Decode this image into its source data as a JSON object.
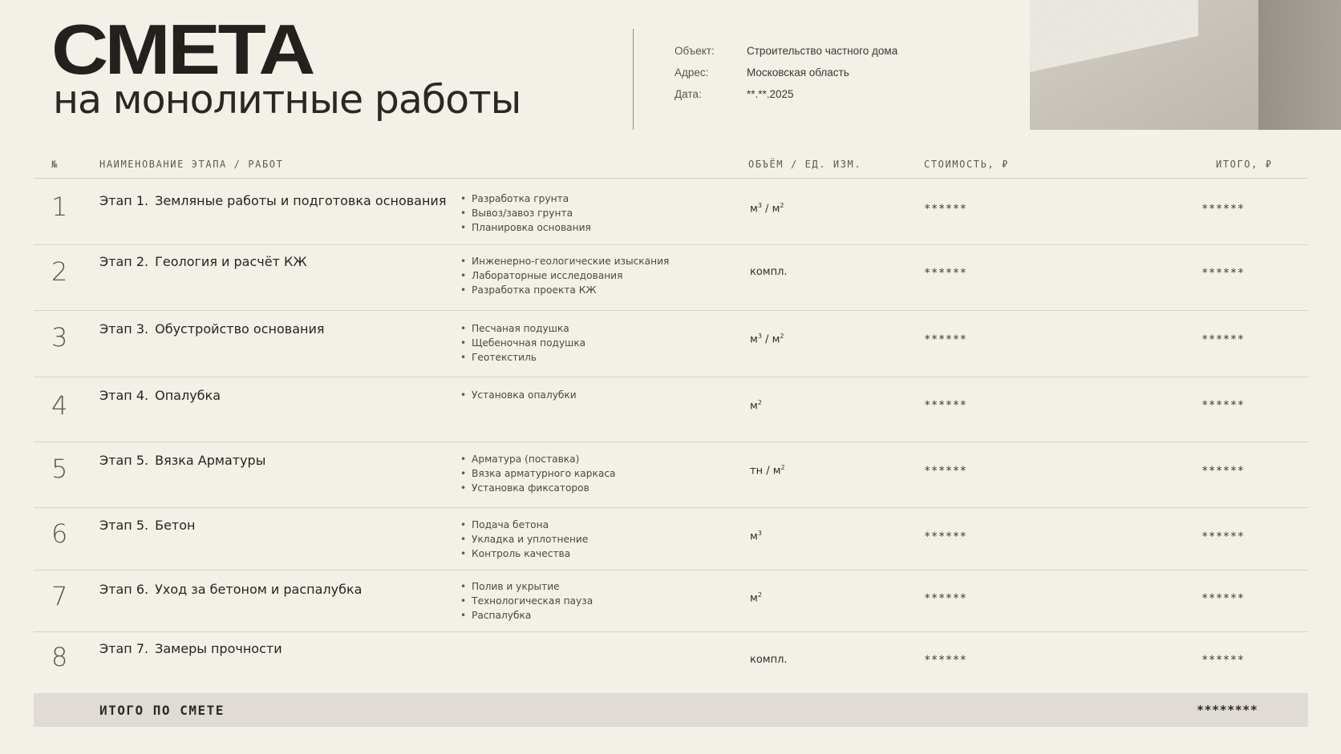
{
  "title": "СМЕТА",
  "subtitle": "на монолитные работы",
  "meta": [
    {
      "key": "Объект:",
      "value": "Строительство частного дома"
    },
    {
      "key": "Адрес:",
      "value": "Московская область"
    },
    {
      "key": "Дата:",
      "value": "**.**.2025"
    }
  ],
  "header": {
    "num": "№",
    "name": "НАИМЕНОВАНИЕ ЭТАПА / РАБОТ",
    "unit": "ОБЪЁМ / ЕД. ИЗМ.",
    "cost": "СТОИМОСТЬ, ₽",
    "total": "ИТОГО, ₽"
  },
  "rows": [
    {
      "num": "1",
      "label": "Этап 1.",
      "name": "Земляные работы и подготовка основания",
      "items": [
        "Разработка грунта",
        "Вывоз/завоз грунта",
        "Планировка основания"
      ],
      "unit_base": "м",
      "unit_sup": "3",
      "unit_sep": " / ",
      "unit_base2": "м",
      "unit_sup2": "2",
      "cost": "******",
      "total": "******"
    },
    {
      "num": "2",
      "label": "Этап 2.",
      "name": "Геология и расчёт КЖ",
      "items": [
        "Инженерно-геологические изыскания",
        "Лабораторные исследования",
        "Разработка проекта КЖ"
      ],
      "unit_base": "компл.",
      "unit_sup": "",
      "unit_sep": "",
      "unit_base2": "",
      "unit_sup2": "",
      "cost": "******",
      "total": "******"
    },
    {
      "num": "3",
      "label": "Этап 3.",
      "name": "Обустройство основания",
      "items": [
        "Песчаная подушка",
        "Щебеночная подушка",
        "Геотекстиль"
      ],
      "unit_base": "м",
      "unit_sup": "3",
      "unit_sep": " / ",
      "unit_base2": "м",
      "unit_sup2": "2",
      "cost": "******",
      "total": "******"
    },
    {
      "num": "4",
      "label": "Этап 4.",
      "name": "Опалубка",
      "items": [
        "Установка опалубки"
      ],
      "unit_base": "м",
      "unit_sup": "2",
      "unit_sep": "",
      "unit_base2": "",
      "unit_sup2": "",
      "cost": "******",
      "total": "******"
    },
    {
      "num": "5",
      "label": "Этап 5.",
      "name": "Вязка Арматуры",
      "items": [
        "Арматура (поставка)",
        "Вязка арматурного каркаса",
        "Установка фиксаторов"
      ],
      "unit_base": "тн",
      "unit_sup": "",
      "unit_sep": " / ",
      "unit_base2": "м",
      "unit_sup2": "2",
      "cost": "******",
      "total": "******"
    },
    {
      "num": "6",
      "label": "Этап 5.",
      "name": "Бетон",
      "items": [
        "Подача бетона",
        "Укладка и уплотнение",
        "Контроль качества"
      ],
      "unit_base": "м",
      "unit_sup": "3",
      "unit_sep": "",
      "unit_base2": "",
      "unit_sup2": "",
      "cost": "******",
      "total": "******"
    },
    {
      "num": "7",
      "label": "Этап 6.",
      "name": "Уход за бетоном и распалубка",
      "items": [
        "Полив и укрытие",
        "Технологическая пауза",
        "Распалубка"
      ],
      "unit_base": "м",
      "unit_sup": "2",
      "unit_sep": "",
      "unit_base2": "",
      "unit_sup2": "",
      "cost": "******",
      "total": "******"
    },
    {
      "num": "8",
      "label": "Этап 7.",
      "name": "Замеры прочности",
      "items": [],
      "unit_base": "компл.",
      "unit_sup": "",
      "unit_sep": "",
      "unit_base2": "",
      "unit_sup2": "",
      "cost": "******",
      "total": "******"
    }
  ],
  "footer": {
    "label": "ИТОГО ПО СМЕТЕ",
    "value": "********"
  },
  "colors": {
    "background": "#f3f0e8",
    "footer_band": "#e0dcd5",
    "text": "#2b2925"
  }
}
